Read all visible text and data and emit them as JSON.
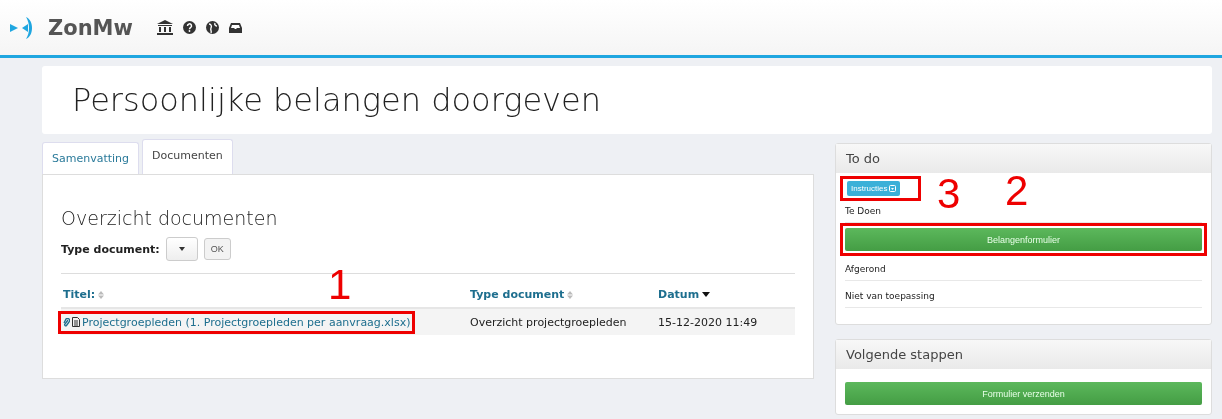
{
  "header": {
    "brand": "ZonMw"
  },
  "page_title": "Persoonlijke belangen doorgeven",
  "tabs": [
    {
      "label": "Samenvatting",
      "selected": false
    },
    {
      "label": "Documenten",
      "selected": true
    }
  ],
  "documents": {
    "heading": "Overzicht documenten",
    "filter_label": "Type document:",
    "ok_button": "OK",
    "columns": [
      {
        "label": "Titel:",
        "sorted": false
      },
      {
        "label": "Type document",
        "sorted": false
      },
      {
        "label": "Datum",
        "sorted": true
      }
    ],
    "rows": [
      {
        "title": "Projectgroepleden (1. Projectgroepleden per aanvraag.xlsx)",
        "type": "Overzicht projectgroepleden",
        "date": "15-12-2020 11:49"
      }
    ]
  },
  "todo": {
    "title": "To do",
    "instructions_button": "Instructies",
    "sections": [
      {
        "label": "Te Doen",
        "buttons": [
          "Belangenformulier"
        ]
      },
      {
        "label": "Afgerond"
      },
      {
        "label": "Niet van toepassing"
      }
    ]
  },
  "next_steps": {
    "title": "Volgende stappen",
    "button": "Formulier verzenden"
  },
  "annotations": [
    {
      "number": "1"
    },
    {
      "number": "2"
    },
    {
      "number": "3"
    }
  ]
}
